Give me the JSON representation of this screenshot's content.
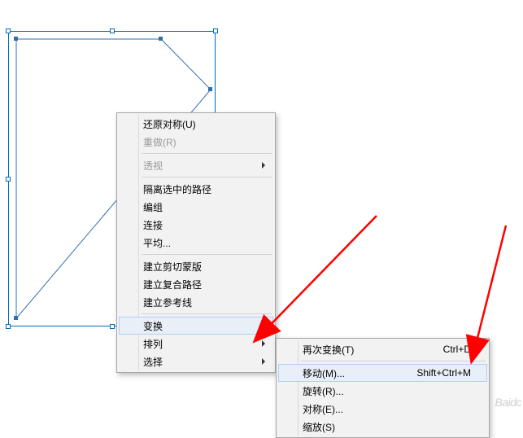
{
  "menu1": {
    "undo": "还原对称(U)",
    "redo": "重做(R)",
    "perspective": "透视",
    "isolate": "隔离选中的路径",
    "group": "编组",
    "connect": "连接",
    "average": "平均...",
    "clip_mask": "建立剪切蒙版",
    "compound_path": "建立复合路径",
    "guides": "建立参考线",
    "transform": "变换",
    "arrange": "排列",
    "select": "选择"
  },
  "menu2": {
    "transform_again": "再次变换(T)",
    "transform_again_key": "Ctrl+D",
    "move": "移动(M)...",
    "move_key": "Shift+Ctrl+M",
    "rotate": "旋转(R)...",
    "reflect": "对称(E)...",
    "scale": "缩放(S)"
  },
  "watermark": "Baidc"
}
